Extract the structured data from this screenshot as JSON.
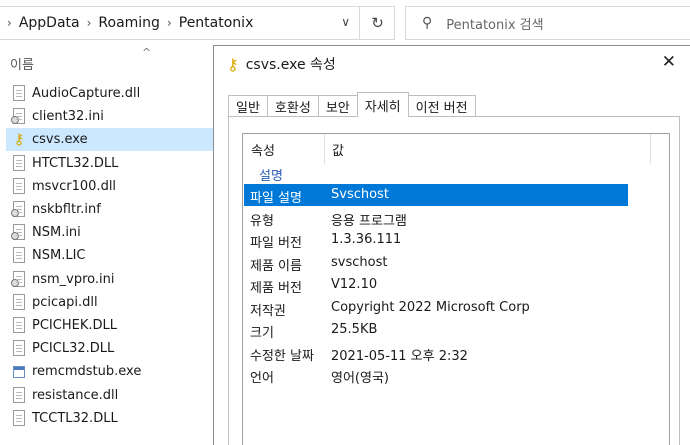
{
  "address": {
    "crumbs": [
      "AppData",
      "Roaming",
      "Pentatonix"
    ],
    "search_placeholder": "Pentatonix 검색"
  },
  "file_list": {
    "column": "이름",
    "files": [
      {
        "name": "AudioCapture.dll",
        "icon": "dll-file-icon"
      },
      {
        "name": "client32.ini",
        "icon": "ini-file-icon"
      },
      {
        "name": "csvs.exe",
        "icon": "key-icon",
        "selected": true
      },
      {
        "name": "HTCTL32.DLL",
        "icon": "dll-file-icon"
      },
      {
        "name": "msvcr100.dll",
        "icon": "dll-file-icon"
      },
      {
        "name": "nskbfltr.inf",
        "icon": "inf-file-icon"
      },
      {
        "name": "NSM.ini",
        "icon": "ini-file-icon"
      },
      {
        "name": "NSM.LIC",
        "icon": "file-icon"
      },
      {
        "name": "nsm_vpro.ini",
        "icon": "ini-file-icon"
      },
      {
        "name": "pcicapi.dll",
        "icon": "dll-file-icon"
      },
      {
        "name": "PCICHEK.DLL",
        "icon": "dll-file-icon"
      },
      {
        "name": "PCICL32.DLL",
        "icon": "dll-file-icon"
      },
      {
        "name": "remcmdstub.exe",
        "icon": "exe-file-icon"
      },
      {
        "name": "resistance.dll",
        "icon": "dll-file-icon"
      },
      {
        "name": "TCCTL32.DLL",
        "icon": "dll-file-icon"
      }
    ]
  },
  "dialog": {
    "title": "csvs.exe 속성",
    "tabs": [
      {
        "label": "일반"
      },
      {
        "label": "호환성"
      },
      {
        "label": "보안"
      },
      {
        "label": "자세히",
        "active": true
      },
      {
        "label": "이전 버전"
      }
    ],
    "columns": {
      "property": "속성",
      "value": "값"
    },
    "group": "설명",
    "rows": [
      {
        "key": "파일 설명",
        "value": "Svschost",
        "selected": true
      },
      {
        "key": "유형",
        "value": "응용 프로그램"
      },
      {
        "key": "파일 버전",
        "value": "1.3.36.111"
      },
      {
        "key": "제품 이름",
        "value": "svschost"
      },
      {
        "key": "제품 버전",
        "value": "V12.10"
      },
      {
        "key": "저작권",
        "value": "Copyright 2022 Microsoft Corp"
      },
      {
        "key": "크기",
        "value": "25.5KB"
      },
      {
        "key": "수정한 날짜",
        "value": "2021-05-11 오후 2:32"
      },
      {
        "key": "언어",
        "value": "영어(영국)"
      }
    ]
  },
  "colors": {
    "selection": "#0078d7",
    "explorer_selection": "#cce8ff",
    "group_text": "#2a5db0"
  }
}
